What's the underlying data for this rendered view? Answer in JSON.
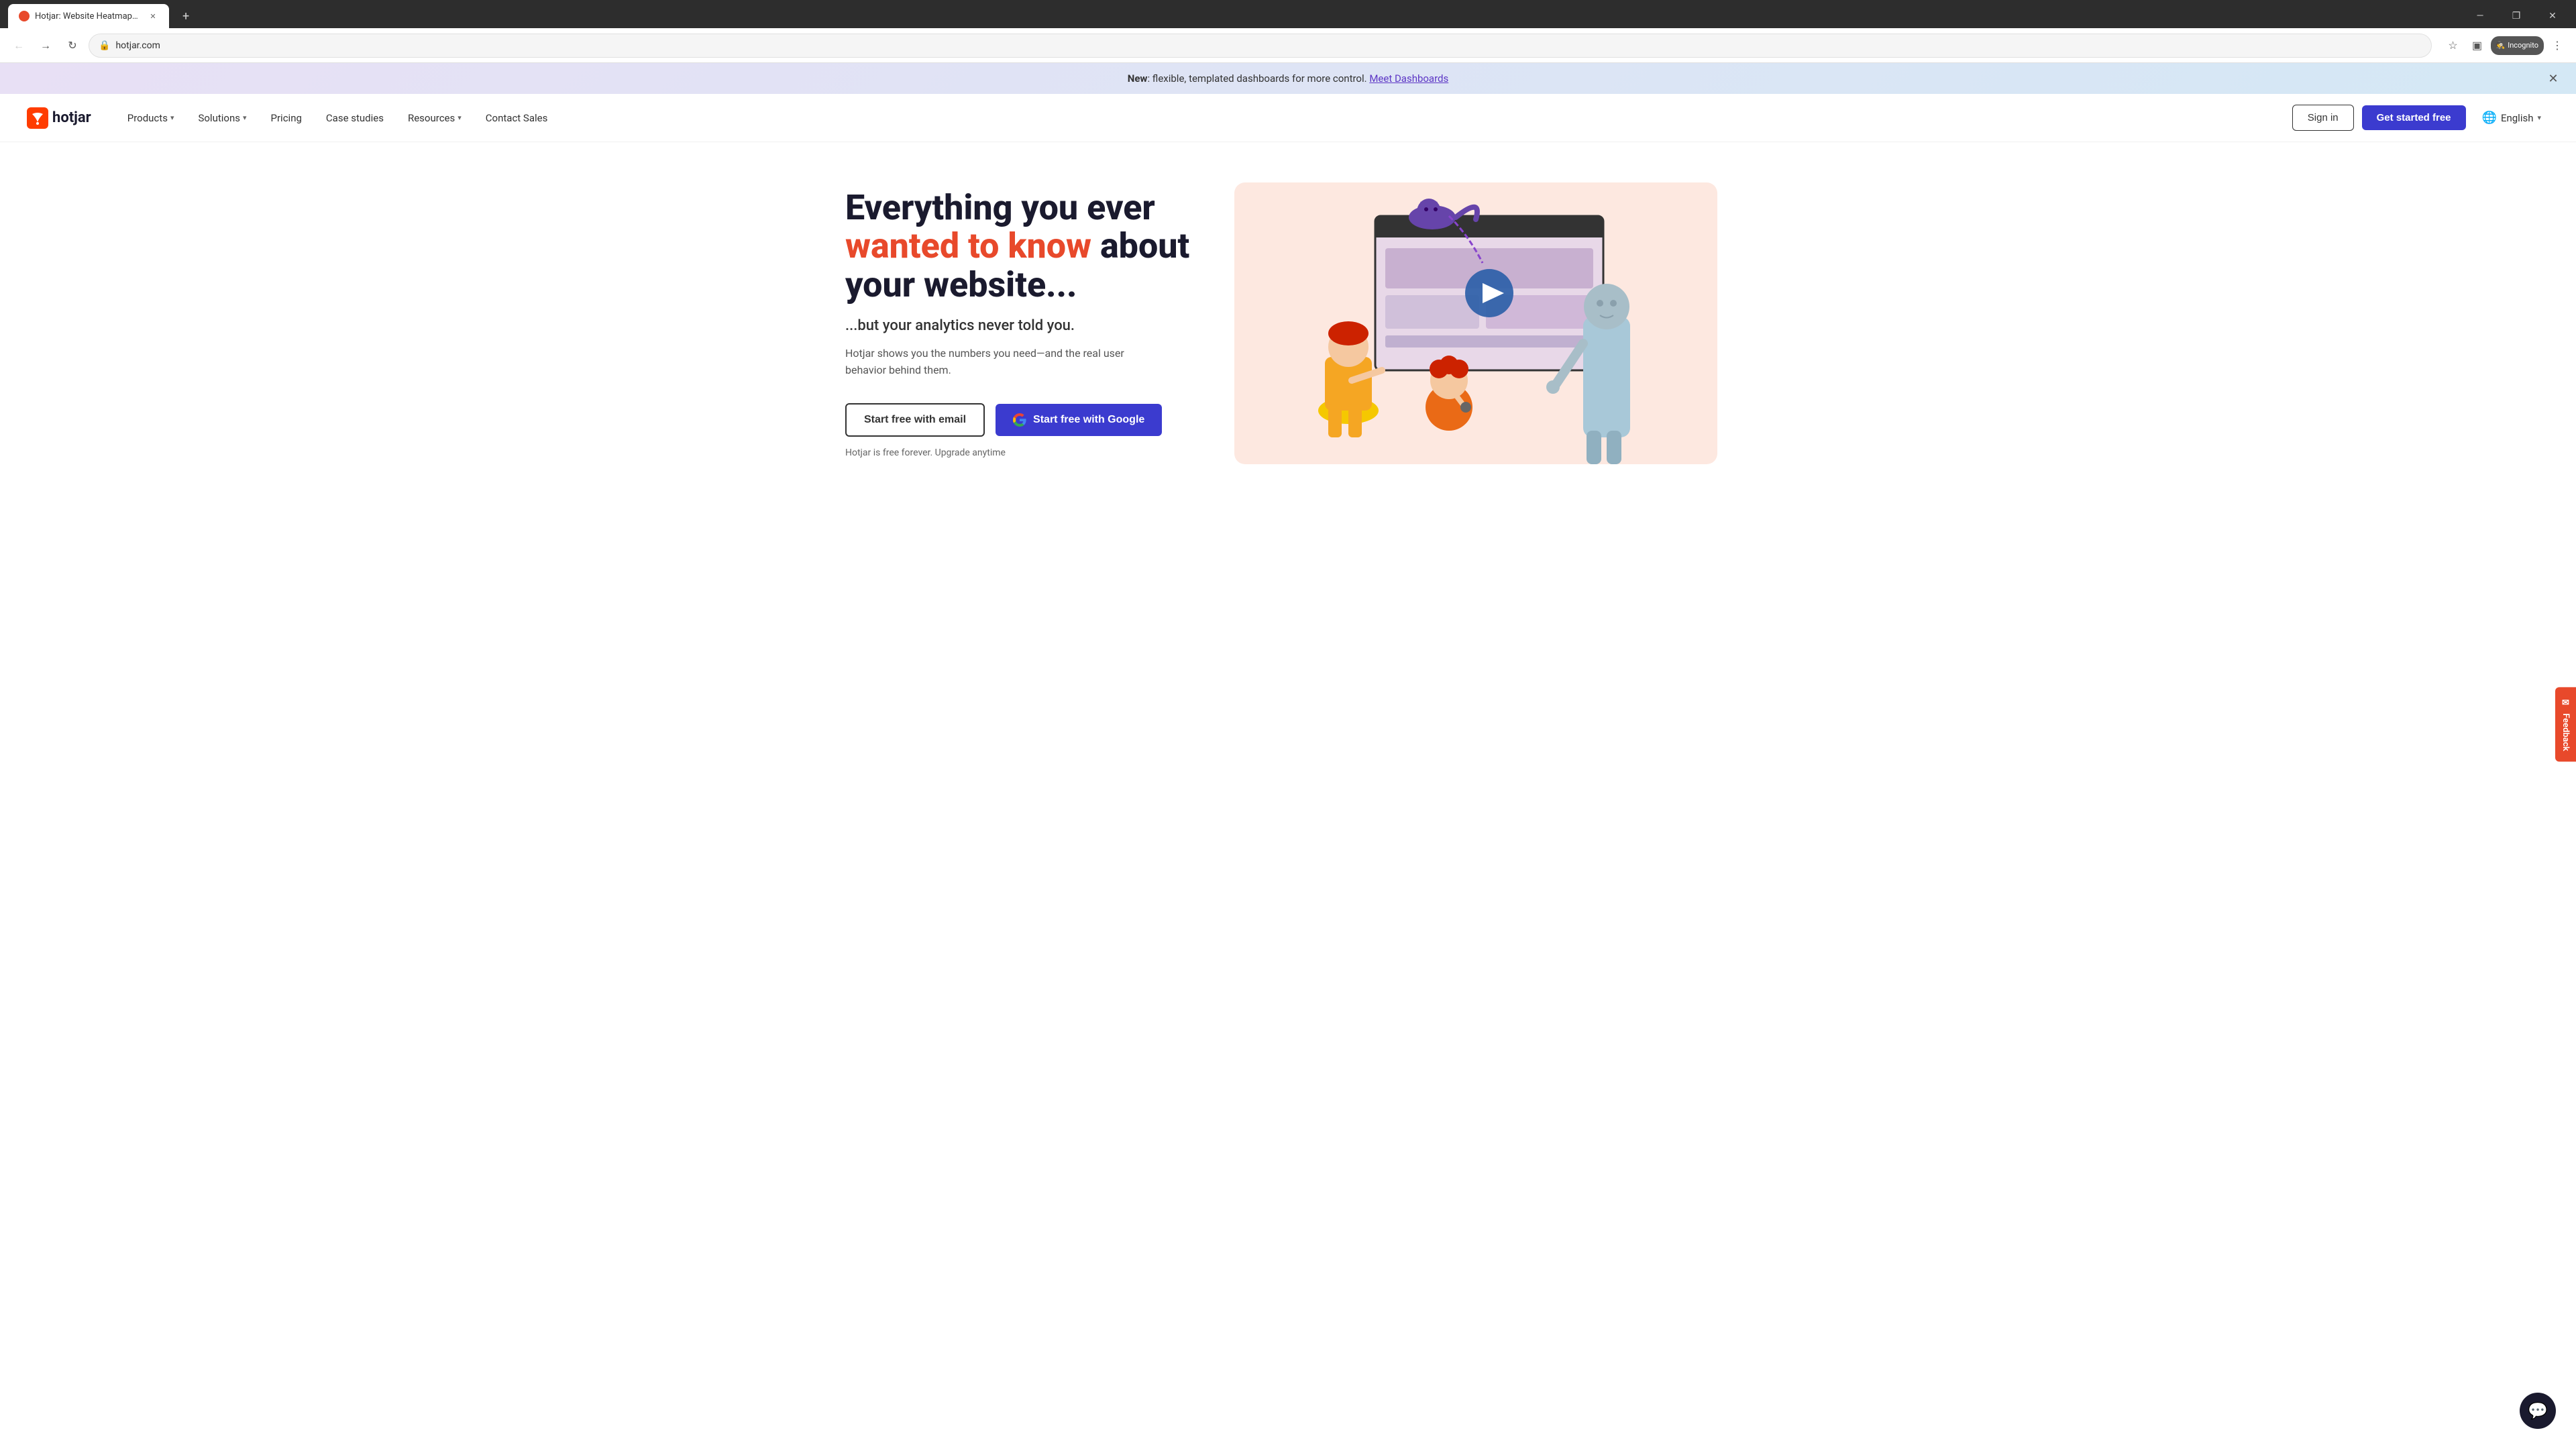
{
  "browser": {
    "tab": {
      "title": "Hotjar: Website Heatmaps & B...",
      "url": "hotjar.com",
      "favicon_color": "#e8492b"
    },
    "incognito_label": "Incognito"
  },
  "banner": {
    "text_prefix": "New",
    "text_body": ": flexible, templated dashboards for more control.",
    "link_text": "Meet Dashboards"
  },
  "nav": {
    "logo_text": "hotjar",
    "products_label": "Products",
    "solutions_label": "Solutions",
    "pricing_label": "Pricing",
    "case_studies_label": "Case studies",
    "resources_label": "Resources",
    "contact_sales_label": "Contact Sales",
    "signin_label": "Sign in",
    "get_started_label": "Get started free",
    "lang_label": "English"
  },
  "hero": {
    "title_line1": "Everything you ever",
    "title_highlight": "wanted to know",
    "title_line2": "about",
    "title_line3": "your website...",
    "subtitle": "...but your analytics never told you.",
    "description_line1": "Hotjar shows you the numbers you need—and the real user",
    "description_line2": "behavior behind them.",
    "btn_email": "Start free with email",
    "btn_google": "Start free with Google",
    "note": "Hotjar is free forever. Upgrade anytime"
  },
  "feedback_tab": "Feedback",
  "chat_btn_label": "Chat"
}
